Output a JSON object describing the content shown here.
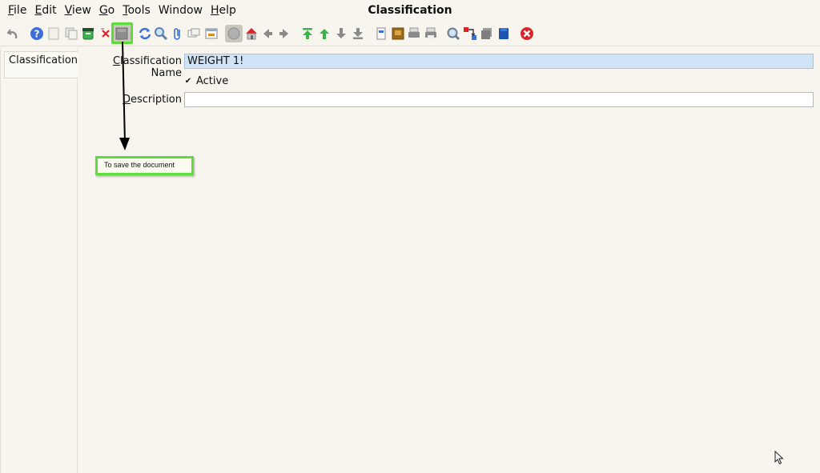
{
  "window": {
    "title": "Classification"
  },
  "menu": [
    {
      "label": "File",
      "mnemonic": "F",
      "rest": "ile"
    },
    {
      "label": "Edit",
      "mnemonic": "E",
      "rest": "dit"
    },
    {
      "label": "View",
      "mnemonic": "V",
      "rest": "iew"
    },
    {
      "label": "Go",
      "mnemonic": "G",
      "rest": "o"
    },
    {
      "label": "Tools",
      "mnemonic": "T",
      "rest": "ools"
    },
    {
      "label": "Window",
      "mnemonic": "",
      "rest": "Window"
    },
    {
      "label": "Help",
      "mnemonic": "H",
      "rest": "elp"
    }
  ],
  "toolbar": {
    "icons": [
      "undo-icon",
      "help-icon",
      "new-record-icon",
      "copy-record-icon",
      "delete-icon",
      "delete-selection-icon",
      "save-icon",
      "refresh-icon",
      "find-icon",
      "attachment-icon",
      "chat-icon",
      "grid-toggle-icon",
      "history-icon",
      "home-icon",
      "previous-icon",
      "next-icon",
      "first-record-icon",
      "previous-record-icon",
      "next-record-icon",
      "last-record-icon",
      "report-icon",
      "archive-icon",
      "print-preview-icon",
      "print-icon",
      "zoom-across-icon",
      "workflow-icon",
      "product-info-icon",
      "request-icon",
      "exit-icon"
    ],
    "colors": {
      "green": "#39b54a",
      "blue": "#3a6fd8",
      "red": "#d9242a",
      "gray": "#8a8a8a"
    }
  },
  "tabs": [
    {
      "label": "Classification"
    }
  ],
  "form": {
    "classification_name": {
      "label_mnemonic": "C",
      "label_rest": "lassification Name",
      "value": "WEIGHT 1!"
    },
    "active": {
      "label": "Active",
      "checked": true,
      "check_glyph": "✔"
    },
    "description": {
      "label_mnemonic": "D",
      "label_rest": "escription",
      "value": ""
    }
  },
  "annotation": {
    "tooltip": "To save the document",
    "highlight_color": "#5ddc3a"
  }
}
